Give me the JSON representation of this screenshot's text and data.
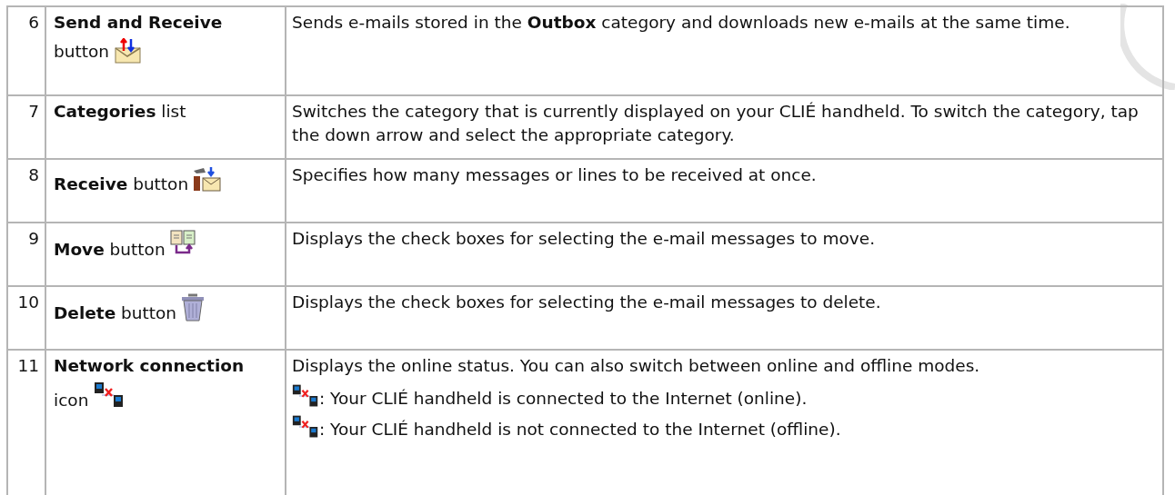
{
  "rows": [
    {
      "number": "6",
      "item": "**Send and Receive**",
      "item_suffix": "button",
      "description": [
        {
          "kind": "text",
          "text": "Sends e-mails stored in the **Outbox** category and downloads new e-mails at the same time."
        }
      ]
    },
    {
      "number": "7",
      "item": "**Categories** list",
      "description": [
        {
          "kind": "text",
          "text": "Switches the category that is currently displayed on your CLIÉ handheld. To switch the category, tap the down arrow and select the appropriate category."
        }
      ]
    },
    {
      "number": "8",
      "item": "**Receive** button",
      "description": [
        {
          "kind": "text",
          "text": "Specifies how many messages or lines to be received at once."
        }
      ]
    },
    {
      "number": "9",
      "item": "**Move** button",
      "description": [
        {
          "kind": "text",
          "text": "Displays the check boxes for selecting the e-mail messages to move."
        }
      ]
    },
    {
      "number": "10",
      "item": "**Delete** button",
      "description": [
        {
          "kind": "text",
          "text": "Displays the check boxes for selecting the e-mail messages to delete."
        }
      ]
    },
    {
      "number": "11",
      "item": "**Network connection**",
      "item_suffix": "icon",
      "description": [
        {
          "kind": "text",
          "text": "Displays the online status. You can also switch between online and offline modes."
        },
        {
          "kind": "status",
          "text": ": Your CLIÉ handheld is connected to the Internet (online)."
        },
        {
          "kind": "status",
          "text": ": Your CLIÉ handheld is not connected to the Internet (offline)."
        }
      ]
    }
  ]
}
